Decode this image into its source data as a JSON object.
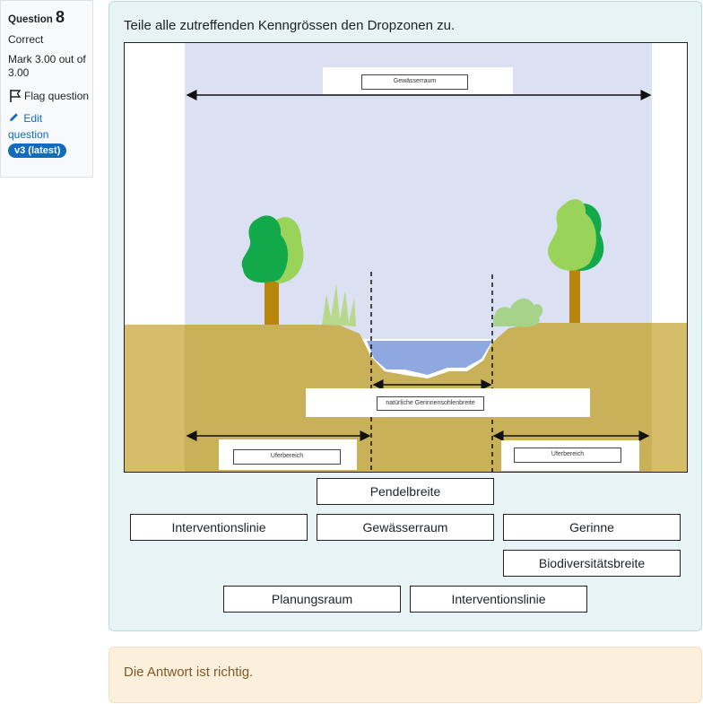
{
  "info": {
    "question_prefix": "Question",
    "question_number": "8",
    "status": "Correct",
    "mark": "Mark 3.00 out of 3.00",
    "flag_label": "Flag question",
    "edit_label": "Edit question",
    "version_badge": "v3 (latest)"
  },
  "question": {
    "text": "Teile alle zutreffenden Kenngrössen den Dropzonen zu."
  },
  "figure": {
    "labels": {
      "gewaesserraum": "Gewässerraum",
      "sohlenbreite": "natürliche Gerinnensohlenbreite",
      "uferbereich_left": "Uferbereich",
      "uferbereich_right": "Uferbereich"
    }
  },
  "choices": [
    "Pendelbreite",
    "Interventionslinie",
    "Gewässerraum",
    "Gerinne",
    "Biodiversitätsbreite",
    "Planungsraum",
    "Interventionslinie"
  ],
  "feedback": "Die Antwort ist richtig.",
  "colors": {
    "sky": "#dbe1f2",
    "soil": "#c9b15a",
    "water": "#8fa8e0",
    "accent": "#0f6cbf"
  }
}
